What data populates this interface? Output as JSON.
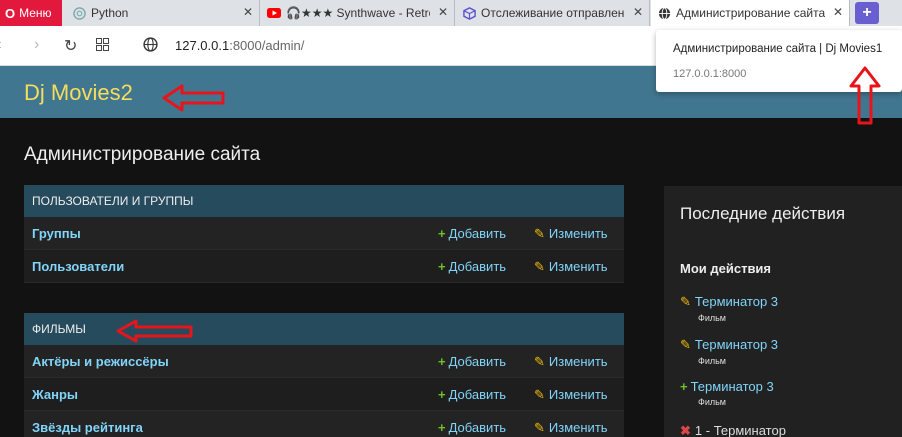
{
  "browser": {
    "menu_label": "Меню",
    "tabs": [
      {
        "label": "Python",
        "icon": "chatgpt-icon"
      },
      {
        "label": "🎧★★★ Synthwave - Retro",
        "icon": "youtube-icon"
      },
      {
        "label": "Отслеживание отправлен",
        "icon": "package-icon"
      },
      {
        "label": "Администрирование сайта",
        "icon": "globe-icon"
      }
    ],
    "url_host": "127.0.0.1",
    "url_path": ":8000/admin/",
    "popup_title": "Администрирование сайта | Dj Movies1",
    "popup_url": "127.0.0.1:8000"
  },
  "site": {
    "brand": "Dj Movies2",
    "page_title": "Администрирование сайта"
  },
  "modules": {
    "auth": {
      "caption": "ПОЛЬЗОВАТЕЛИ И ГРУППЫ",
      "rows": [
        {
          "name": "Группы",
          "add": "Добавить",
          "change": "Изменить"
        },
        {
          "name": "Пользователи",
          "add": "Добавить",
          "change": "Изменить"
        }
      ]
    },
    "movies": {
      "caption": "ФИЛЬМЫ",
      "rows": [
        {
          "name": "Актёры и режиссёры",
          "add": "Добавить",
          "change": "Изменить"
        },
        {
          "name": "Жанры",
          "add": "Добавить",
          "change": "Изменить"
        },
        {
          "name": "Звёзды рейтинга",
          "add": "Добавить",
          "change": "Изменить"
        }
      ]
    }
  },
  "recent": {
    "title": "Последние действия",
    "subtitle": "Мои действия",
    "items": [
      {
        "icon": "pencil-icon",
        "label": "Терминатор 3",
        "type": "Фильм"
      },
      {
        "icon": "pencil-icon",
        "label": "Терминатор 3",
        "type": "Фильм"
      },
      {
        "icon": "plus-icon",
        "label": "Терминатор 3",
        "type": "Фильм"
      },
      {
        "icon": "delete-icon",
        "label": "1 - Терминатор",
        "type": ""
      }
    ]
  },
  "colors": {
    "header": "#417690",
    "brand_text": "#f5dd5d",
    "module_caption": "#264b5d",
    "link": "#81d4fa",
    "arrow": "#e8141b"
  }
}
